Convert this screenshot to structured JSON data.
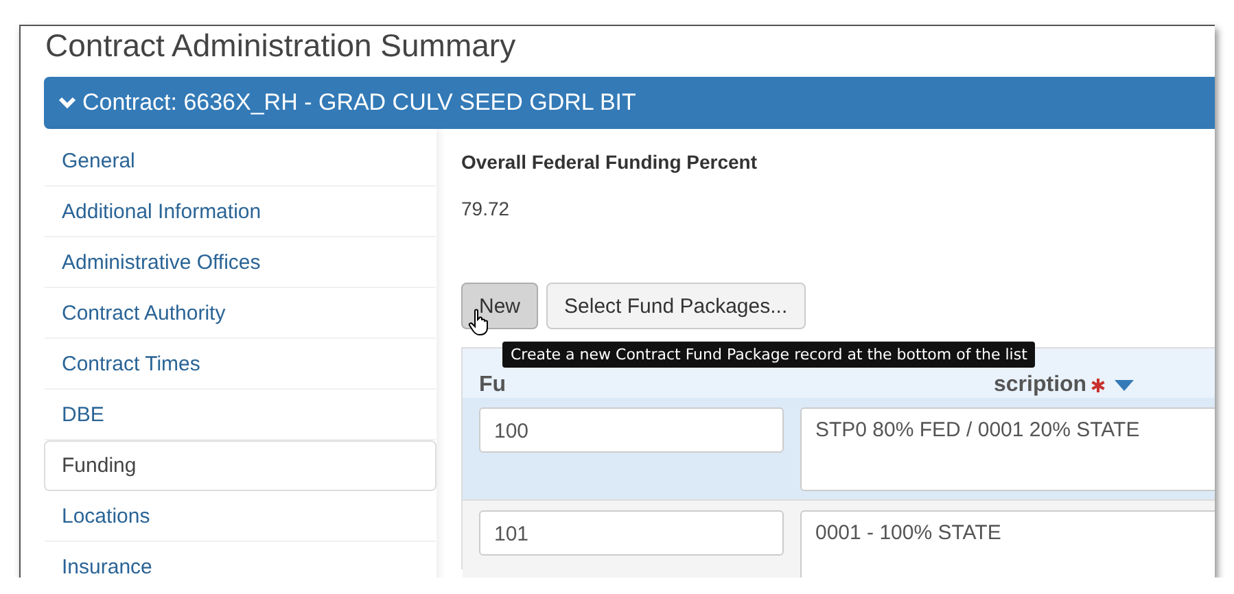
{
  "page_title": "Contract Administration Summary",
  "contract_bar": {
    "expanded": true,
    "label": "Contract: 6636X_RH - GRAD CULV SEED GDRL BIT"
  },
  "sidebar": {
    "items": [
      {
        "label": "General",
        "selected": false
      },
      {
        "label": "Additional Information",
        "selected": false
      },
      {
        "label": "Administrative Offices",
        "selected": false
      },
      {
        "label": "Contract Authority",
        "selected": false
      },
      {
        "label": "Contract Times",
        "selected": false
      },
      {
        "label": "DBE",
        "selected": false
      },
      {
        "label": "Funding",
        "selected": true
      },
      {
        "label": "Locations",
        "selected": false
      },
      {
        "label": "Insurance",
        "selected": false
      }
    ]
  },
  "field": {
    "label": "Overall Federal Funding Percent",
    "value": "79.72"
  },
  "buttons": [
    {
      "label": "New",
      "hovered": true
    },
    {
      "label": "Select Fund Packages...",
      "hovered": false
    }
  ],
  "tooltip": "Create a new Contract Fund Package record at the bottom of the list",
  "table": {
    "columns": [
      {
        "label": "Fu",
        "required": false
      },
      {
        "label": "scription",
        "required": true
      }
    ],
    "rows": [
      {
        "selected": true,
        "column_1": "100",
        "column_2": "STP0 80% FED / 0001 20% STATE"
      },
      {
        "selected": false,
        "column_1": "101",
        "column_2": "0001 - 100% STATE"
      }
    ]
  }
}
